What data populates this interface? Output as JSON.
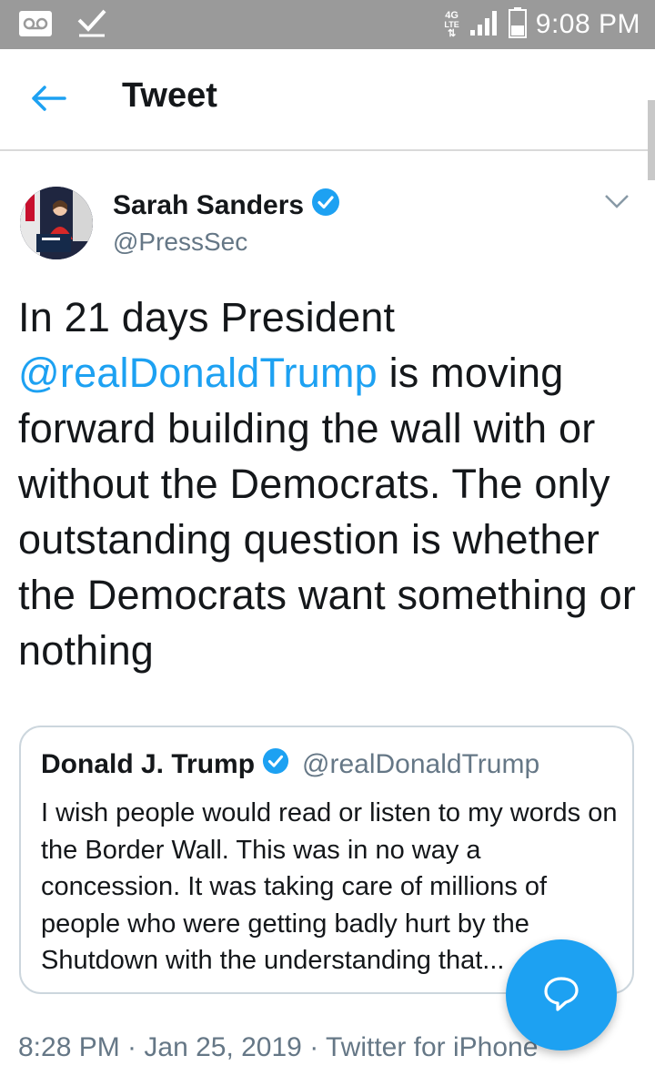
{
  "status_bar": {
    "time": "9:08 PM",
    "network_top": "4G",
    "network_bottom": "LTE",
    "icons": [
      "voicemail-icon",
      "check-icon",
      "network-4g-lte-icon",
      "signal-icon",
      "battery-icon"
    ]
  },
  "app_bar": {
    "title": "Tweet",
    "back_icon": "arrow-left-icon"
  },
  "tweet": {
    "author_name": "Sarah Sanders",
    "author_handle": "@PressSec",
    "verified": true,
    "text_before": "In 21 days President ",
    "mention": "@realDonaldTrump",
    "text_after": " is moving forward building the wall with or without the Democrats. The only outstanding question is whether the Democrats want something or nothing",
    "timestamp": "8:28 PM · Jan 25, 2019 · Twitter for iPhone"
  },
  "quoted_tweet": {
    "author_name": "Donald J. Trump",
    "author_handle": "@realDonaldTrump",
    "verified": true,
    "text": "I wish people would read or listen to my words on the Border Wall. This was in no way a concession. It was taking care of millions of people who were getting badly hurt by the Shutdown with the understanding that..."
  },
  "fab": {
    "icon": "reply-bubble-icon"
  },
  "colors": {
    "accent": "#1da1f2",
    "status_bar": "#9a9a9a",
    "secondary_text": "#657786",
    "border": "#ccd6dd"
  }
}
